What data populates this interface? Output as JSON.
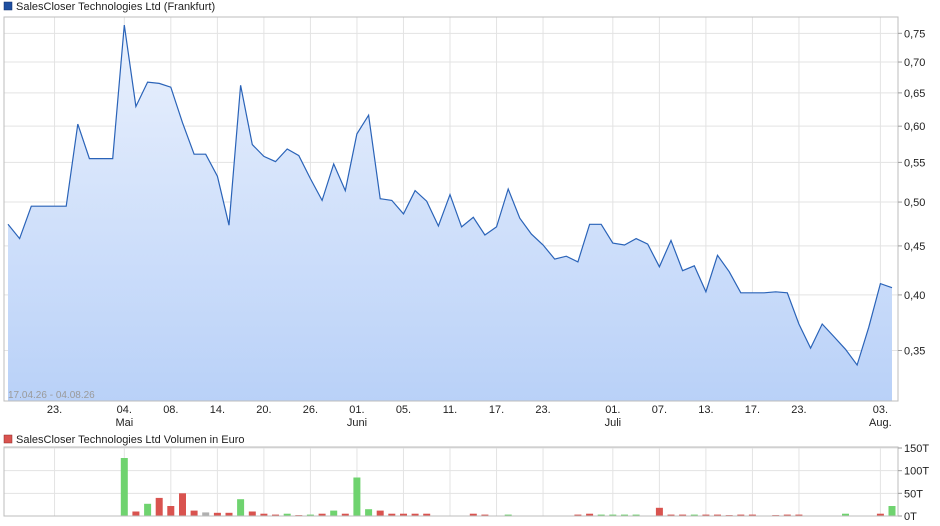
{
  "price_chart": {
    "legend": "SalesCloser Technologies Ltd (Frankfurt)",
    "legend_color": "#1f4fa0",
    "date_range": "17.04.26 - 04.08.26",
    "line_color": "#2a63b8",
    "fill_top_color": "#eaf1fd",
    "fill_bottom_color": "#b9d1f8",
    "y_ticks": [
      "0,75",
      "0,70",
      "0,65",
      "0,60",
      "0,55",
      "0,50",
      "0,45",
      "0,40",
      "0,35"
    ],
    "x_ticks": [
      {
        "label": "23.",
        "sub": ""
      },
      {
        "label": "04.",
        "sub": "Mai"
      },
      {
        "label": "08.",
        "sub": ""
      },
      {
        "label": "14.",
        "sub": ""
      },
      {
        "label": "20.",
        "sub": ""
      },
      {
        "label": "26.",
        "sub": ""
      },
      {
        "label": "01.",
        "sub": "Juni"
      },
      {
        "label": "05.",
        "sub": ""
      },
      {
        "label": "11.",
        "sub": ""
      },
      {
        "label": "17.",
        "sub": ""
      },
      {
        "label": "23.",
        "sub": ""
      },
      {
        "label": "01.",
        "sub": "Juli"
      },
      {
        "label": "07.",
        "sub": ""
      },
      {
        "label": "13.",
        "sub": ""
      },
      {
        "label": "17.",
        "sub": ""
      },
      {
        "label": "23.",
        "sub": ""
      },
      {
        "label": "03.",
        "sub": "Aug."
      }
    ]
  },
  "volume_chart": {
    "legend": "SalesCloser Technologies Ltd Volumen in Euro",
    "legend_color": "#d9534f",
    "y_ticks": [
      "150T",
      "100T",
      "50T",
      "0T"
    ],
    "up_color": "#6fd36f",
    "down_color": "#d9534f",
    "neutral_color": "#b0b0b0"
  },
  "chart_data": [
    {
      "type": "line",
      "title": "SalesCloser Technologies Ltd (Frankfurt)",
      "ylabel": "",
      "ylim": [
        0.31,
        0.78
      ],
      "y_scale": "log",
      "grid": true,
      "x": [
        "17.04.26",
        "20.04.26",
        "21.04.26",
        "22.04.26",
        "23.04.26",
        "24.04.26",
        "27.04.26",
        "28.04.26",
        "29.04.26",
        "30.04.26",
        "04.05.26",
        "05.05.26",
        "06.05.26",
        "07.05.26",
        "08.05.26",
        "11.05.26",
        "12.05.26",
        "13.05.26",
        "14.05.26",
        "15.05.26",
        "18.05.26",
        "19.05.26",
        "20.05.26",
        "21.05.26",
        "22.05.26",
        "25.05.26",
        "26.05.26",
        "27.05.26",
        "28.05.26",
        "29.05.26",
        "01.06.26",
        "02.06.26",
        "03.06.26",
        "04.06.26",
        "05.06.26",
        "08.06.26",
        "09.06.26",
        "10.06.26",
        "11.06.26",
        "12.06.26",
        "15.06.26",
        "16.06.26",
        "17.06.26",
        "18.06.26",
        "19.06.26",
        "22.06.26",
        "23.06.26",
        "24.06.26",
        "25.06.26",
        "26.06.26",
        "29.06.26",
        "30.06.26",
        "01.07.26",
        "02.07.26",
        "03.07.26",
        "06.07.26",
        "07.07.26",
        "08.07.26",
        "09.07.26",
        "10.07.26",
        "13.07.26",
        "14.07.26",
        "15.07.26",
        "16.07.26",
        "17.07.26",
        "20.07.26",
        "21.07.26",
        "22.07.26",
        "23.07.26",
        "24.07.26",
        "27.07.26",
        "28.07.26",
        "29.07.26",
        "30.07.26",
        "31.07.26",
        "03.08.26",
        "04.08.26"
      ],
      "series": [
        {
          "name": "SalesCloser Technologies Ltd (Frankfurt)",
          "values": [
            0.474,
            0.458,
            0.495,
            0.495,
            0.495,
            0.495,
            0.603,
            0.555,
            0.555,
            0.555,
            0.765,
            0.629,
            0.667,
            0.665,
            0.659,
            0.605,
            0.561,
            0.561,
            0.532,
            0.473,
            0.662,
            0.574,
            0.558,
            0.551,
            0.568,
            0.559,
            0.529,
            0.502,
            0.548,
            0.514,
            0.589,
            0.616,
            0.504,
            0.502,
            0.486,
            0.514,
            0.501,
            0.472,
            0.509,
            0.471,
            0.482,
            0.462,
            0.471,
            0.516,
            0.481,
            0.463,
            0.451,
            0.436,
            0.439,
            0.433,
            0.474,
            0.474,
            0.453,
            0.451,
            0.458,
            0.452,
            0.428,
            0.456,
            0.424,
            0.429,
            0.403,
            0.44,
            0.423,
            0.402,
            0.402,
            0.402,
            0.403,
            0.402,
            0.373,
            0.352,
            0.373,
            0.362,
            0.351,
            0.338,
            0.37,
            0.411,
            0.407
          ]
        }
      ]
    },
    {
      "type": "bar",
      "title": "SalesCloser Technologies Ltd Volumen in Euro",
      "ylim": [
        0,
        150
      ],
      "unit": "T",
      "grid": true,
      "x": [
        "17.04.26",
        "20.04.26",
        "21.04.26",
        "22.04.26",
        "23.04.26",
        "24.04.26",
        "27.04.26",
        "28.04.26",
        "29.04.26",
        "30.04.26",
        "04.05.26",
        "05.05.26",
        "06.05.26",
        "07.05.26",
        "08.05.26",
        "11.05.26",
        "12.05.26",
        "13.05.26",
        "14.05.26",
        "15.05.26",
        "18.05.26",
        "19.05.26",
        "20.05.26",
        "21.05.26",
        "22.05.26",
        "25.05.26",
        "26.05.26",
        "27.05.26",
        "28.05.26",
        "29.05.26",
        "01.06.26",
        "02.06.26",
        "03.06.26",
        "04.06.26",
        "05.06.26",
        "08.06.26",
        "09.06.26",
        "10.06.26",
        "11.06.26",
        "12.06.26",
        "15.06.26",
        "16.06.26",
        "17.06.26",
        "18.06.26",
        "19.06.26",
        "22.06.26",
        "23.06.26",
        "24.06.26",
        "25.06.26",
        "26.06.26",
        "29.06.26",
        "30.06.26",
        "01.07.26",
        "02.07.26",
        "03.07.26",
        "06.07.26",
        "07.07.26",
        "08.07.26",
        "09.07.26",
        "10.07.26",
        "13.07.26",
        "14.07.26",
        "15.07.26",
        "16.07.26",
        "17.07.26",
        "20.07.26",
        "21.07.26",
        "22.07.26",
        "23.07.26",
        "24.07.26",
        "27.07.26",
        "28.07.26",
        "29.07.26",
        "30.07.26",
        "31.07.26",
        "03.08.26",
        "04.08.26"
      ],
      "series": [
        {
          "name": "SalesCloser Technologies Ltd Volumen in Euro",
          "values": [
            0,
            0,
            0,
            0,
            0,
            0,
            0,
            0,
            0,
            0,
            128,
            10,
            27,
            40,
            22,
            50,
            12,
            8,
            7,
            7,
            37,
            10,
            5,
            3,
            5,
            2,
            3,
            5,
            12,
            5,
            85,
            15,
            12,
            5,
            5,
            5,
            5,
            0,
            0,
            0,
            5,
            3,
            0,
            3,
            0,
            0,
            0,
            0,
            0,
            3,
            5,
            3,
            3,
            3,
            3,
            0,
            18,
            3,
            3,
            3,
            3,
            3,
            2,
            3,
            3,
            0,
            2,
            3,
            3,
            0,
            0,
            0,
            5,
            0,
            0,
            5,
            22
          ],
          "direction": [
            "0",
            "0",
            "0",
            "0",
            "0",
            "0",
            "0",
            "0",
            "0",
            "0",
            "up",
            "down",
            "up",
            "down",
            "down",
            "down",
            "down",
            "neutral",
            "down",
            "down",
            "up",
            "down",
            "down",
            "down",
            "up",
            "down",
            "up",
            "down",
            "up",
            "down",
            "up",
            "up",
            "down",
            "down",
            "down",
            "down",
            "down",
            "0",
            "0",
            "0",
            "down",
            "down",
            "0",
            "up",
            "0",
            "0",
            "0",
            "0",
            "0",
            "down",
            "down",
            "up",
            "up",
            "up",
            "up",
            "0",
            "down",
            "down",
            "down",
            "up",
            "down",
            "down",
            "down",
            "down",
            "down",
            "0",
            "down",
            "down",
            "down",
            "0",
            "0",
            "0",
            "up",
            "0",
            "0",
            "down",
            "up"
          ]
        }
      ]
    }
  ]
}
